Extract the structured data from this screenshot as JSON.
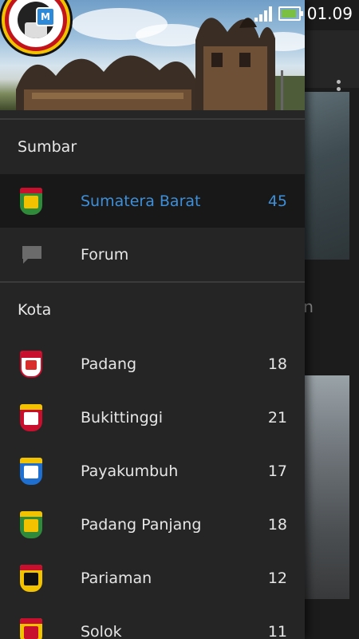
{
  "status_bar": {
    "time": "01.09",
    "notification_icons": [
      "image-notification-icon",
      "app-m-icon",
      "sim-icon"
    ],
    "system_icons": [
      "signal-icon",
      "battery-charging-icon"
    ]
  },
  "drawer": {
    "sections": [
      {
        "title": "Sumbar",
        "items": [
          {
            "label": "Sumatera Barat",
            "count": "45",
            "icon": "sumatera-barat-emblem-icon",
            "selected": true
          },
          {
            "label": "Forum",
            "count": "",
            "icon": "chat-bubble-icon",
            "selected": false
          }
        ]
      },
      {
        "title": "Kota",
        "items": [
          {
            "label": "Padang",
            "count": "18",
            "icon": "padang-emblem-icon"
          },
          {
            "label": "Bukittinggi",
            "count": "21",
            "icon": "bukittinggi-emblem-icon"
          },
          {
            "label": "Payakumbuh",
            "count": "17",
            "icon": "payakumbuh-emblem-icon"
          },
          {
            "label": "Padang Panjang",
            "count": "18",
            "icon": "padang-panjang-emblem-icon"
          },
          {
            "label": "Pariaman",
            "count": "12",
            "icon": "pariaman-emblem-icon"
          },
          {
            "label": "Solok",
            "count": "11",
            "icon": "solok-emblem-icon"
          }
        ]
      }
    ]
  },
  "background_content": {
    "partial_text": "an"
  },
  "colors": {
    "accent": "#3e8fd8",
    "drawer_bg": "#252525",
    "selected_bg": "#181818",
    "text": "#e6e6e6"
  }
}
